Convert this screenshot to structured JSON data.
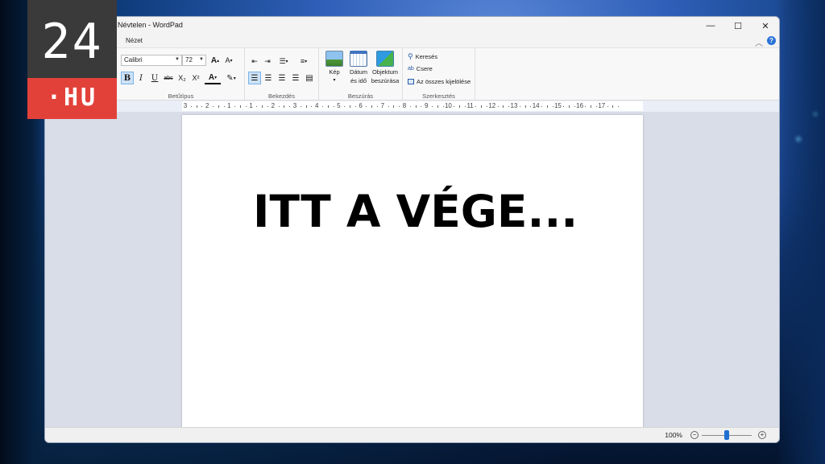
{
  "window": {
    "title": "Névtelen - WordPad",
    "minimize": "—",
    "maximize": "☐",
    "close": "✕"
  },
  "menu": {
    "view": "Nézet"
  },
  "ribbon": {
    "font": {
      "label": "Betűtípus",
      "family": "Calibri",
      "size": "72",
      "grow": "A",
      "shrink": "A",
      "bold": "B",
      "italic": "I",
      "underline": "U",
      "strike": "abc",
      "subscript": "X₂",
      "superscript": "X²",
      "color": "A",
      "highlight": "✎"
    },
    "paragraph": {
      "label": "Bekezdés"
    },
    "insert": {
      "label": "Beszúrás",
      "picture": "Kép",
      "datetime_1": "Dátum",
      "datetime_2": "és idő",
      "object_1": "Objektum",
      "object_2": "beszúrása"
    },
    "editing": {
      "label": "Szerkesztés",
      "find": "Keresés",
      "replace": "Csere",
      "select_all": "Az összes kijelölése"
    }
  },
  "ruler": {
    "ticks": [
      "3",
      "2",
      "1",
      "1",
      "2",
      "3",
      "4",
      "5",
      "6",
      "7",
      "8",
      "9",
      "10",
      "11",
      "12",
      "13",
      "14",
      "15",
      "16",
      "17"
    ]
  },
  "document": {
    "text": "ITT A VÉGE..."
  },
  "status": {
    "zoom": "100%",
    "zoom_minus": "−",
    "zoom_plus": "+",
    "zoom_level": 0.5
  },
  "logo": {
    "number": "24",
    "suffix": "·HU"
  },
  "colors": {
    "accent": "#1f6fd1",
    "logo_red": "#e2413a",
    "logo_dark": "#3a3a3a"
  }
}
